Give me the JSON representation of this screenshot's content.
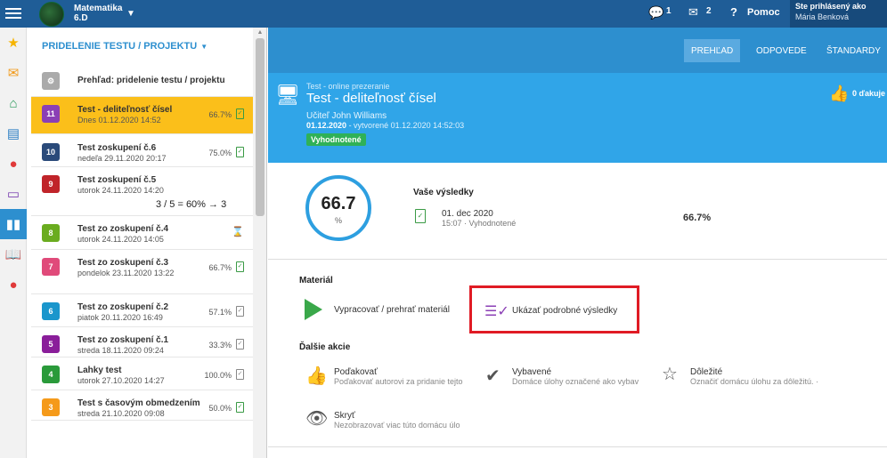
{
  "topbar": {
    "class_name": "Matematika",
    "class_group": "6.D",
    "chat_count": "1",
    "mail_count": "2",
    "help_label": "Pomoc",
    "user_logged_label": "Ste prihlásený ako",
    "user_name": "Mária Benková"
  },
  "list": {
    "header": "PRIDELENIE TESTU / PROJEKTU",
    "overview": "Prehľad: pridelenie testu / projektu",
    "items": [
      {
        "num": "11",
        "title": "Test - deliteľnosť čísel",
        "date": "Dnes 01.12.2020 14:52",
        "score": "66.7%",
        "color": "#8b3fb5"
      },
      {
        "num": "10",
        "title": "Test zoskupení č.6",
        "date": "nedeľa 29.11.2020 20:17",
        "score": "75.0%",
        "color": "#2a4a7a"
      },
      {
        "num": "9",
        "title": "Test zoskupení č.5",
        "date": "utorok 24.11.2020 14:20",
        "score": "",
        "formula": "3 / 5 = 60% → 3",
        "color": "#c0242a"
      },
      {
        "num": "8",
        "title": "Test zo zoskupení č.4",
        "date": "utorok 24.11.2020 14:05",
        "score": "",
        "color": "#6aac1f"
      },
      {
        "num": "7",
        "title": "Test zo zoskupení č.3",
        "date": "pondelok 23.11.2020 13:22",
        "score": "66.7%",
        "color": "#e04a7a"
      },
      {
        "num": "6",
        "title": "Test zo zoskupení č.2",
        "date": "piatok 20.11.2020 16:49",
        "score": "57.1%",
        "color": "#1a96cc"
      },
      {
        "num": "5",
        "title": "Test zo zoskupení č.1",
        "date": "streda 18.11.2020 09:24",
        "score": "33.3%",
        "color": "#8a1e9a"
      },
      {
        "num": "4",
        "title": "Lahky test",
        "date": "utorok 27.10.2020 14:27",
        "score": "100.0%",
        "color": "#2a9a3a"
      },
      {
        "num": "3",
        "title": "Test s časovým obmedzením",
        "date": "streda 21.10.2020 09:08",
        "score": "50.0%",
        "color": "#f59a1a"
      }
    ]
  },
  "tabs": [
    "PREHĽAD",
    "ODPOVEDE",
    "ŠTANDARDY"
  ],
  "hero": {
    "subtitle": "Test - online prezeranie",
    "title": "Test - deliteľnosť čísel",
    "teacher": "Učiteľ John Williams",
    "date": "01.12.2020",
    "created": "- vytvorené 01.12.2020 14:52:03",
    "status": "Vyhodnotené",
    "likes": "0 ďakuje"
  },
  "results": {
    "score": "66.7",
    "unit": "%",
    "title": "Vaše výsledky",
    "date": "01. dec 2020",
    "time": "15:07 · Vyhodnotené",
    "percent": "66.7%"
  },
  "material": {
    "label": "Materiál",
    "play_label": "Vypracovať / prehrať materiál",
    "detail_label": "Ukázať podrobné výsledky"
  },
  "more": {
    "label": "Ďalšie akcie",
    "thanks_title": "Poďakovať",
    "thanks_desc": "Poďakovať autorovi za pridanie tejto",
    "done_title": "Vybavené",
    "done_desc": "Domáce úlohy označené ako vybav",
    "important_title": "Dôležité",
    "important_desc": "Označiť domácu úlohu za dôležitú. ·",
    "hide_title": "Skryť",
    "hide_desc": "Nezobrazovať viac túto domácu úlo"
  }
}
